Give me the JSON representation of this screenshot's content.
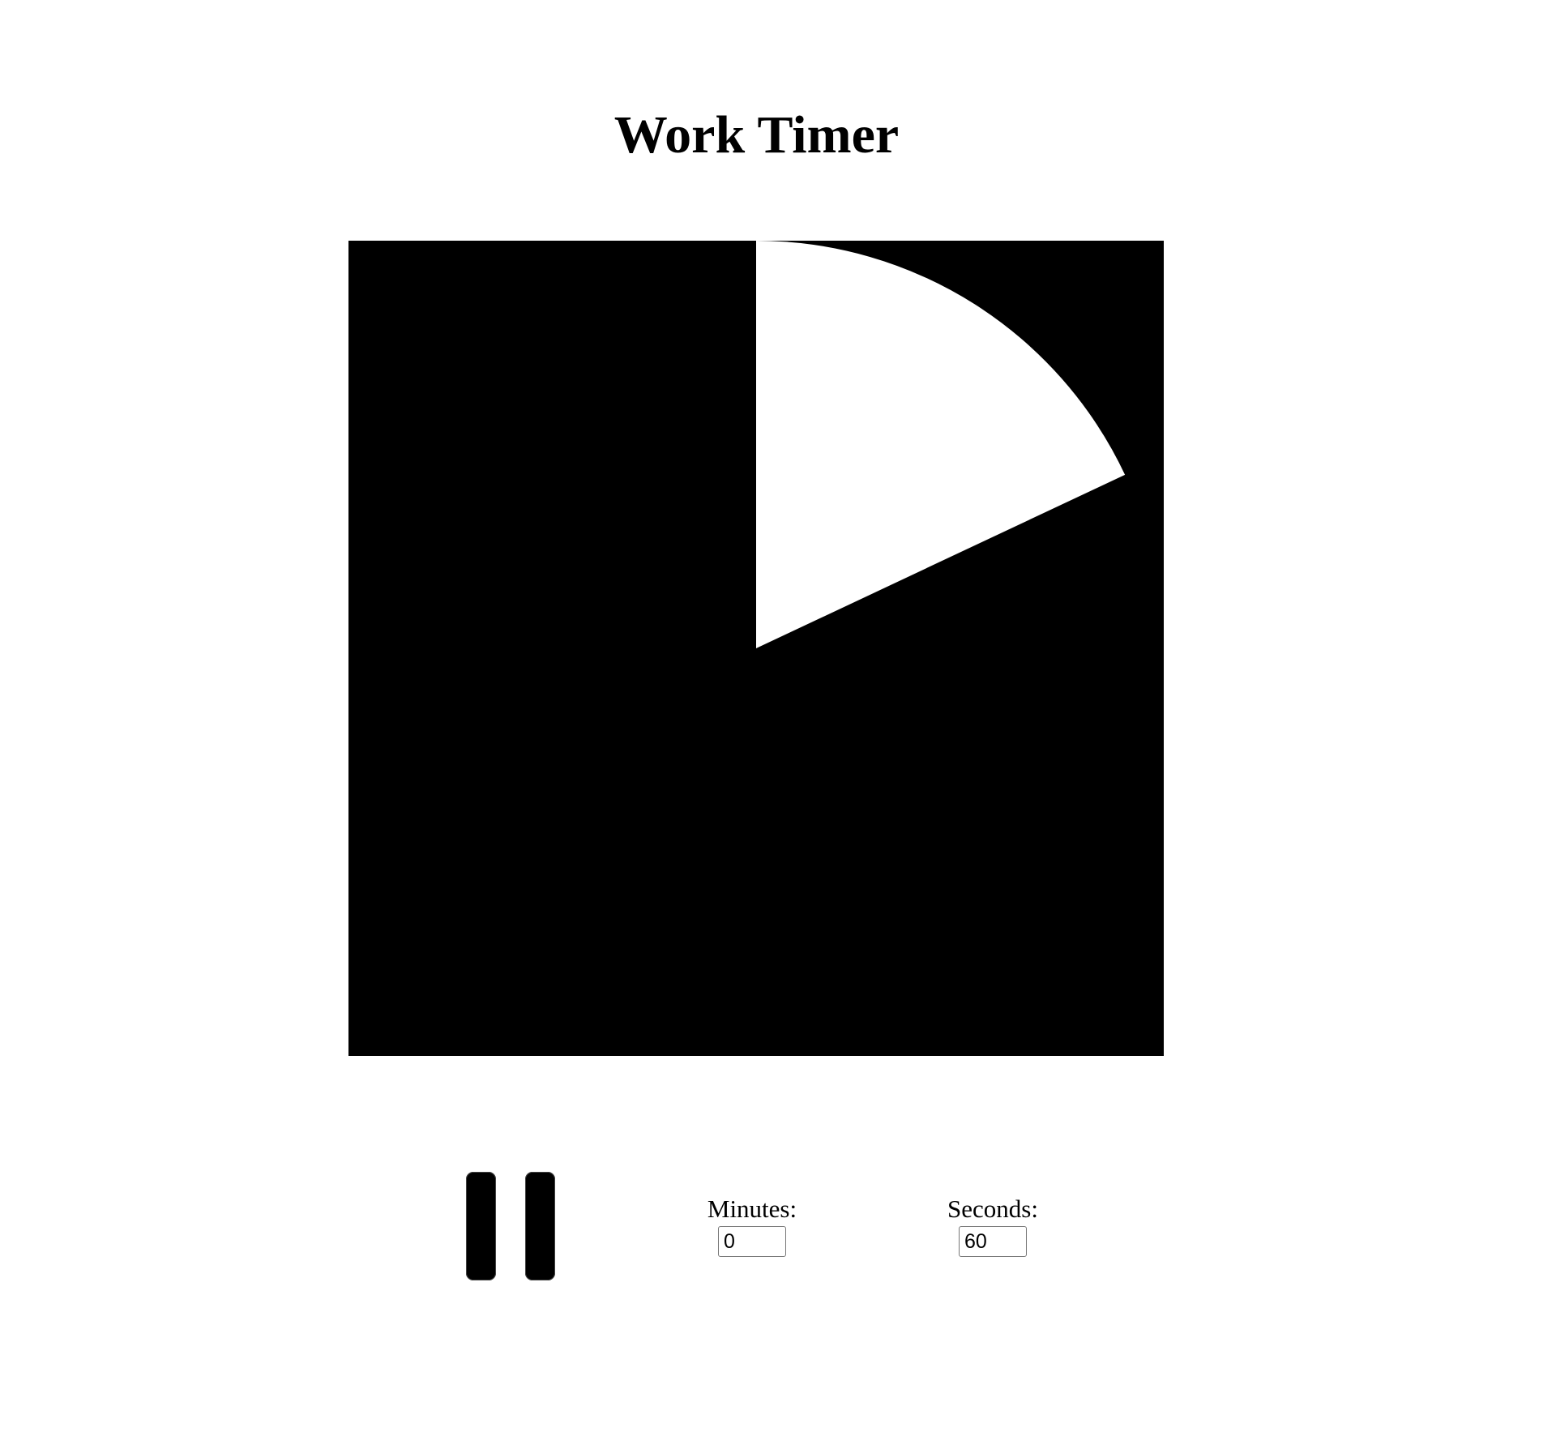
{
  "page": {
    "title": "Work Timer"
  },
  "timer": {
    "remaining_fraction": 0.18,
    "foreground_color": "#000000",
    "remaining_color": "#ffffff"
  },
  "controls": {
    "pause_button": {
      "icon": "pause-icon",
      "color": "#000000"
    },
    "minutes": {
      "label": "Minutes:",
      "value": "0"
    },
    "seconds": {
      "label": "Seconds:",
      "value": "60"
    }
  }
}
